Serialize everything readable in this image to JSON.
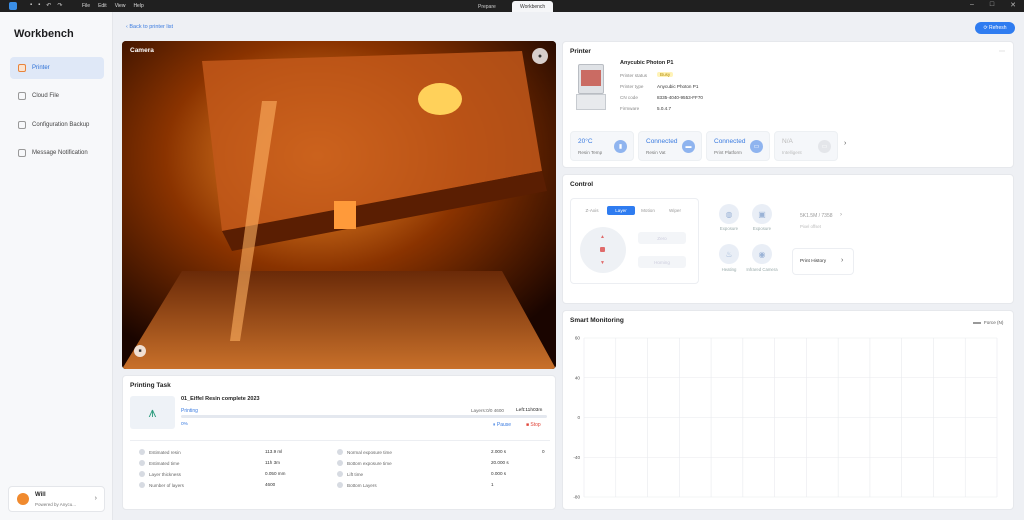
{
  "titlebar": {
    "menu": [
      "File",
      "Edit",
      "View",
      "Help"
    ],
    "tabs": [
      "Prepare",
      "Workbench"
    ]
  },
  "sidebar": {
    "title": "Workbench",
    "items": [
      {
        "label": "Printer",
        "active": true
      },
      {
        "label": "Cloud File"
      },
      {
        "label": "Configuration Backup"
      },
      {
        "label": "Message Notification"
      }
    ],
    "user": {
      "name": "Will",
      "subtitle": "Powered by Anycu..."
    }
  },
  "header": {
    "back_label": "Back to printer list",
    "refresh_label": "Refresh"
  },
  "camera": {
    "label": "Camera"
  },
  "printing_task": {
    "title": "Printing Task",
    "file": "01_Eiffel Resin complete 2023",
    "status": "Printing",
    "layers": "Layers:0/0 4600",
    "left": "Left:11h03m",
    "progress_text": "0%",
    "progress": 0.0,
    "pause_label": "Pause",
    "stop_label": "Stop",
    "stats_left": [
      {
        "label": "Estimated resin",
        "value": "113.9 ml"
      },
      {
        "label": "Estimated time",
        "value": "11h 3m"
      },
      {
        "label": "Layer thickness",
        "value": "0.050 mm"
      },
      {
        "label": "Number of layers",
        "value": "4600"
      }
    ],
    "stats_right": [
      {
        "label": "Normal exposure time",
        "value": "2.000 s"
      },
      {
        "label": "Bottom exposure time",
        "value": "20.000 s"
      },
      {
        "label": "Lift time",
        "value": "0.000 s"
      },
      {
        "label": "Bottom Layers",
        "value": "1"
      }
    ],
    "extra": "0"
  },
  "printer": {
    "title": "Printer",
    "name": "Anycubic Photon P1",
    "rows": [
      {
        "label": "Printer status",
        "value": "Busy"
      },
      {
        "label": "Printer type",
        "value": "Anycubic Photon P1"
      },
      {
        "label": "CN code",
        "value": "8335-4040-9553-FF70"
      },
      {
        "label": "Firmware",
        "value": "5.0.4.7"
      }
    ],
    "tiles": [
      {
        "value": "20°C",
        "label": "Resin Temp"
      },
      {
        "value": "Connected",
        "label": "Resin Vat"
      },
      {
        "value": "Connected",
        "label": "Print Platform"
      },
      {
        "value": "N/A",
        "label": "Intelligent"
      }
    ]
  },
  "control": {
    "title": "Control",
    "tabs": [
      "Z-Axis",
      "Layer",
      "Motion",
      "Wiper"
    ],
    "actions": [
      "Zero",
      "Homing"
    ],
    "buttons": [
      {
        "label": "Exposure"
      },
      {
        "label": "Exposure"
      },
      {
        "label": "Heating"
      },
      {
        "label": "Infrared Camera"
      }
    ],
    "resolution": "5K1.5M / 7358",
    "resolution_label": "Pixel offset",
    "history_label": "Print History"
  },
  "monitoring": {
    "title": "Smart Monitoring",
    "legend": "Force (N)",
    "chart_data": {
      "type": "line",
      "series": [
        {
          "name": "Force (N)",
          "values": []
        }
      ],
      "yticks": [
        60,
        40,
        0,
        -40,
        -80
      ],
      "ylim": [
        -80,
        60
      ],
      "grid": true,
      "legend_placement": "top-right"
    }
  },
  "colors": {
    "accent": "#2f7cf0",
    "orange": "#f08a2e",
    "bg": "#eef0f4"
  }
}
